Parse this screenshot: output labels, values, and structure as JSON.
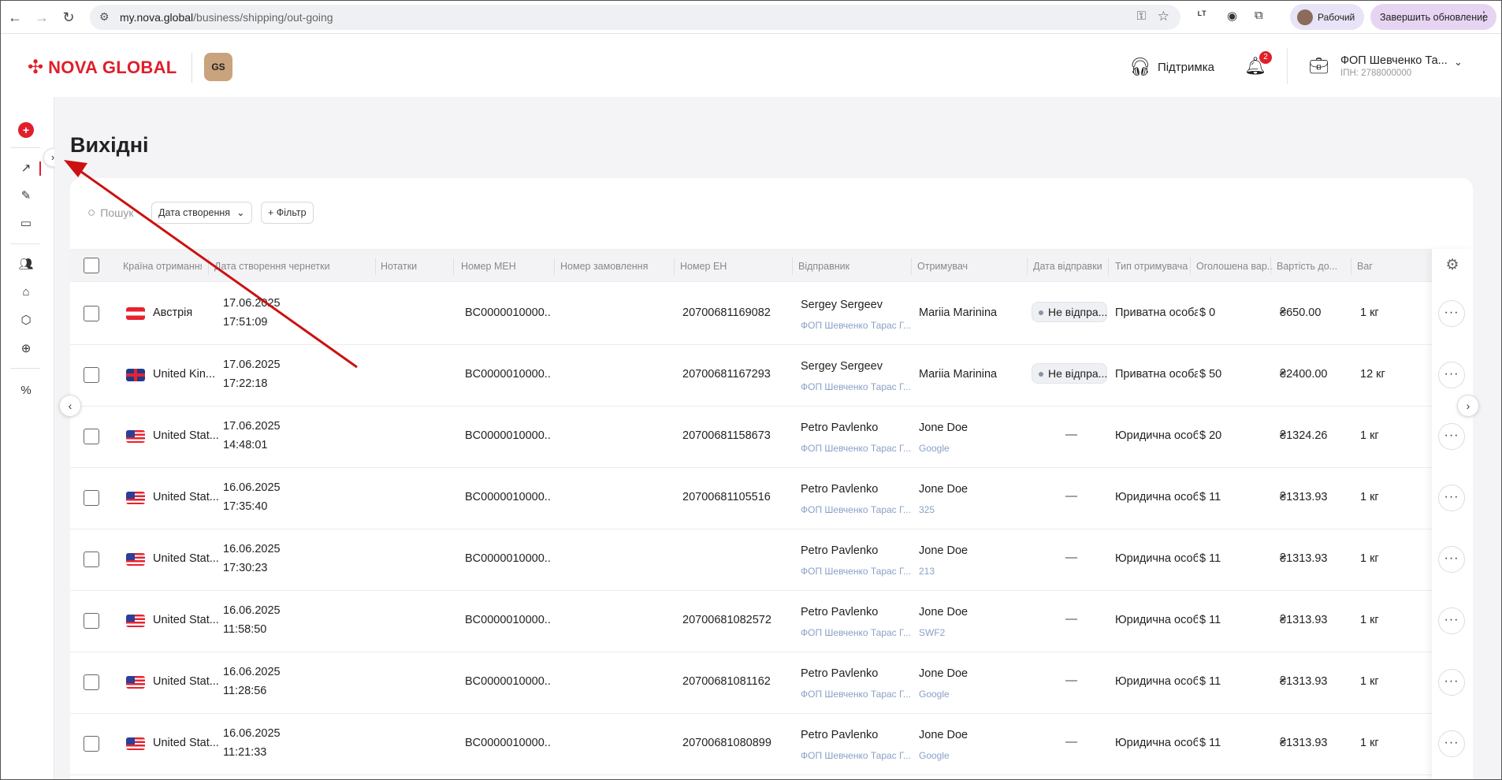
{
  "browser": {
    "url_host": "my.nova.global",
    "url_path": "/business/shipping/out-going",
    "profile_label": "Рабочий",
    "update_label": "Завершить обновление"
  },
  "header": {
    "logo_text": "NOVA GLOBAL",
    "badge_text": "GS",
    "support_label": "Підтримка",
    "notifications_count": "2",
    "account_name": "ФОП Шевченко Та...",
    "account_tax": "ІПН: 2788000000"
  },
  "page": {
    "title": "Вихідні",
    "search_placeholder": "Пошук",
    "date_filter_label": "Дата створення",
    "add_filter_label": "+ Фільтр"
  },
  "table": {
    "columns": [
      "Країна отримання",
      "Дата створення чернетки",
      "Нотатки",
      "Номер МЕН",
      "Номер замовлення",
      "Номер ЕН",
      "Відправник",
      "Отримувач",
      "Дата відправки",
      "Тип отримувача",
      "Оголошена вар...",
      "Вартість до...",
      "Ваг"
    ],
    "rows": [
      {
        "flag": "at",
        "country": "Австрія",
        "date": "17.06.2025",
        "time": "17:51:09",
        "men": "BC0000010000...",
        "en": "20700681169082",
        "sender": "Sergey Sergeev",
        "sender_sub": "ФОП Шевченко Тарас Г...",
        "recipient": "Mariia Marinina",
        "recipient_sub": "",
        "status": "Не відпра...",
        "type": "Приватна особа",
        "declared": "$ 0",
        "cost": "₴650.00",
        "weight": "1 кг"
      },
      {
        "flag": "gb",
        "country": "United Kin...",
        "date": "17.06.2025",
        "time": "17:22:18",
        "men": "BC0000010000...",
        "en": "20700681167293",
        "sender": "Sergey Sergeev",
        "sender_sub": "ФОП Шевченко Тарас Г...",
        "recipient": "Mariia Marinina",
        "recipient_sub": "",
        "status": "Не відпра...",
        "type": "Приватна особа",
        "declared": "$ 50",
        "cost": "₴2400.00",
        "weight": "12 кг"
      },
      {
        "flag": "us",
        "country": "United Stat...",
        "date": "17.06.2025",
        "time": "14:48:01",
        "men": "BC0000010000...",
        "en": "20700681158673",
        "sender": "Petro Pavlenko",
        "sender_sub": "ФОП Шевченко Тарас Г...",
        "recipient": "Jone Doe",
        "recipient_sub": "Google",
        "status": "",
        "type": "Юридична особа",
        "declared": "$ 20",
        "cost": "₴1324.26",
        "weight": "1 кг"
      },
      {
        "flag": "us",
        "country": "United Stat...",
        "date": "16.06.2025",
        "time": "17:35:40",
        "men": "BC0000010000...",
        "en": "20700681105516",
        "sender": "Petro Pavlenko",
        "sender_sub": "ФОП Шевченко Тарас Г...",
        "recipient": "Jone Doe",
        "recipient_sub": "325",
        "status": "",
        "type": "Юридична особа",
        "declared": "$ 11",
        "cost": "₴1313.93",
        "weight": "1 кг"
      },
      {
        "flag": "us",
        "country": "United Stat...",
        "date": "16.06.2025",
        "time": "17:30:23",
        "men": "BC0000010000...",
        "en": "",
        "sender": "Petro Pavlenko",
        "sender_sub": "ФОП Шевченко Тарас Г...",
        "recipient": "Jone Doe",
        "recipient_sub": "213",
        "status": "",
        "type": "Юридична особа",
        "declared": "$ 11",
        "cost": "₴1313.93",
        "weight": "1 кг"
      },
      {
        "flag": "us",
        "country": "United Stat...",
        "date": "16.06.2025",
        "time": "11:58:50",
        "men": "BC0000010000...",
        "en": "20700681082572",
        "sender": "Petro Pavlenko",
        "sender_sub": "ФОП Шевченко Тарас Г...",
        "recipient": "Jone Doe",
        "recipient_sub": "SWF2",
        "status": "",
        "type": "Юридична особа",
        "declared": "$ 11",
        "cost": "₴1313.93",
        "weight": "1 кг"
      },
      {
        "flag": "us",
        "country": "United Stat...",
        "date": "16.06.2025",
        "time": "11:28:56",
        "men": "BC0000010000...",
        "en": "20700681081162",
        "sender": "Petro Pavlenko",
        "sender_sub": "ФОП Шевченко Тарас Г...",
        "recipient": "Jone Doe",
        "recipient_sub": "Google",
        "status": "",
        "type": "Юридична особа",
        "declared": "$ 11",
        "cost": "₴1313.93",
        "weight": "1 кг"
      },
      {
        "flag": "us",
        "country": "United Stat...",
        "date": "16.06.2025",
        "time": "11:21:33",
        "men": "BC0000010000...",
        "en": "20700681080899",
        "sender": "Petro Pavlenko",
        "sender_sub": "ФОП Шевченко Тарас Г...",
        "recipient": "Jone Doe",
        "recipient_sub": "Google",
        "status": "",
        "type": "Юридична особа",
        "declared": "$ 11",
        "cost": "₴1313.93",
        "weight": "1 кг"
      }
    ],
    "empty_mark": "—",
    "more_glyph": "···"
  },
  "icons": {
    "back": "arrow-left-icon",
    "forward": "arrow-right-icon",
    "reload": "reload-icon",
    "support": "headset-icon",
    "bell": "bell-icon",
    "account": "briefcase-icon",
    "settings": "gear-icon"
  },
  "colors": {
    "brand_red": "#e01e2a",
    "annotation_arrow": "#cc1111"
  }
}
